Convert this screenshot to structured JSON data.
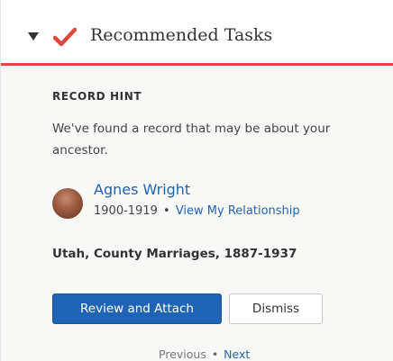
{
  "header": {
    "title": "Recommended Tasks",
    "toggle_icon": "chevron-down-icon",
    "task_icon": "checkmark-icon",
    "accent_color": "#e0483e"
  },
  "hint": {
    "label": "RECORD HINT",
    "message": "We've found a record that may be about your ancestor."
  },
  "person": {
    "name": "Agnes Wright",
    "lifespan": "1900-1919",
    "separator": "•",
    "relationship_link": "View My Relationship"
  },
  "record": {
    "collection": "Utah, County Marriages, 1887-1937"
  },
  "actions": {
    "primary_label": "Review and Attach",
    "secondary_label": "Dismiss",
    "primary_color": "#1f63b5"
  },
  "pager": {
    "previous": "Previous",
    "separator": "•",
    "next": "Next"
  }
}
